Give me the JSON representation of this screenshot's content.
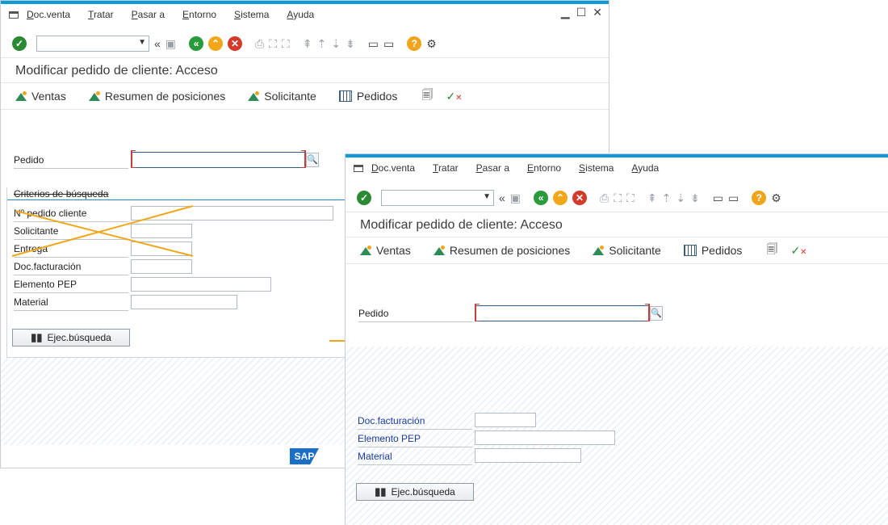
{
  "menu": [
    "Doc.venta",
    "Tratar",
    "Pasar a",
    "Entorno",
    "Sistema",
    "Ayuda"
  ],
  "menu_underline": [
    "D",
    "T",
    "P",
    "E",
    "S",
    "A"
  ],
  "page_title": "Modificar pedido de cliente: Acceso",
  "app_buttons": [
    "Ventas",
    "Resumen de posiciones",
    "Solicitante",
    "Pedidos"
  ],
  "pedido_label": "Pedido",
  "group_title": "Criterios de búsqueda",
  "left_fields": [
    "Nº pedido cliente",
    "Solicitante",
    "Entrega",
    "Doc.facturación",
    "Elemento PEP",
    "Material"
  ],
  "right_fields": [
    "Doc.facturación",
    "Elemento PEP",
    "Material"
  ],
  "search_button": "Ejec.búsqueda",
  "sap_logo": "SAP",
  "colors": {
    "accent": "#0a9bd8",
    "arrow": "#f2a71a",
    "field_blue": "#1a3aa0"
  },
  "icons": [
    "enter-icon",
    "back-icon",
    "save-icon",
    "green-back-icon",
    "exit-icon",
    "cancel-icon",
    "print-icon",
    "find-icon",
    "find-next-icon",
    "page-icons",
    "new-session-icon",
    "shortcut-icon",
    "help-icon",
    "settings-icon"
  ]
}
